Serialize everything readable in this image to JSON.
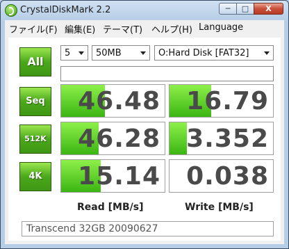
{
  "window": {
    "title": "CrystalDiskMark 2.2",
    "controls": {
      "minimize": "─",
      "maximize": "□",
      "close": "X"
    }
  },
  "menu": [
    "ファイル(F)",
    "編集(E)",
    "テーマ(T)",
    "ヘルプ(H)",
    "Language"
  ],
  "controls": {
    "all_button": "All",
    "test_count": "5",
    "test_size": "50MB",
    "drive": "O:Hard Disk [FAT32]"
  },
  "tests": [
    {
      "label": "Seq",
      "read": "46.48",
      "write": "16.79",
      "read_fill": 0.42,
      "write_fill": 0.4
    },
    {
      "label": "512K",
      "read": "46.28",
      "write": "3.352",
      "read_fill": 0.36,
      "write_fill": 0.17
    },
    {
      "label": "4K",
      "read": "15.14",
      "write": "0.038",
      "read_fill": 0.38,
      "write_fill": 0.0
    }
  ],
  "columns": {
    "read": "Read [MB/s]",
    "write": "Write [MB/s]"
  },
  "comment": "Transcend 32GB 20090627",
  "colors": {
    "bar_green": "#5fd324",
    "button_green": "#4aa81a",
    "number_gray": "#4a4a4a"
  }
}
